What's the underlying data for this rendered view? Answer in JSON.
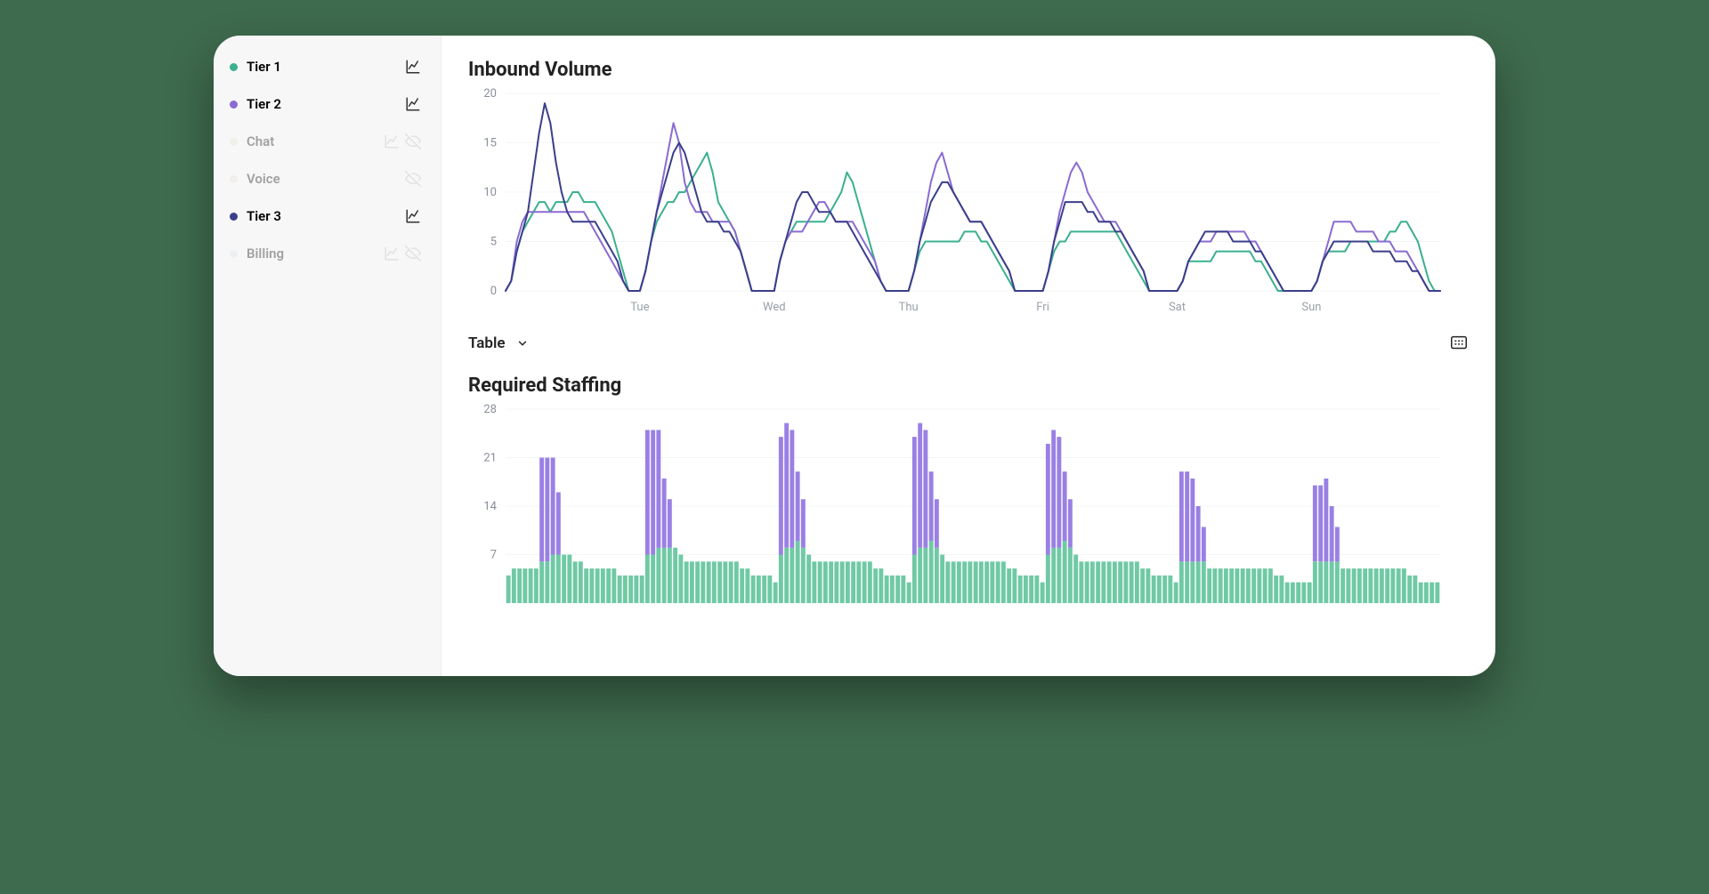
{
  "sidebar": {
    "items": [
      {
        "label": "Tier 1",
        "color": "#3bb08f",
        "active": true,
        "chart": true,
        "hidden": false
      },
      {
        "label": "Tier 2",
        "color": "#8a6bd1",
        "active": true,
        "chart": true,
        "hidden": false
      },
      {
        "label": "Chat",
        "color": "#d6cfa0",
        "active": false,
        "chart": true,
        "hidden": true
      },
      {
        "label": "Voice",
        "color": "#d9c7b8",
        "active": false,
        "chart": false,
        "hidden": true
      },
      {
        "label": "Tier 3",
        "color": "#3b3f8a",
        "active": true,
        "chart": true,
        "hidden": false
      },
      {
        "label": "Billing",
        "color": "#bcd3df",
        "active": false,
        "chart": true,
        "hidden": true
      }
    ]
  },
  "controls": {
    "table_label": "Table"
  },
  "chart_data": [
    {
      "type": "line",
      "title": "Inbound Volume",
      "ylim": [
        0,
        20
      ],
      "yticks": [
        0,
        5,
        10,
        15,
        20
      ],
      "xticks": [
        "Tue",
        "Wed",
        "Thu",
        "Fri",
        "Sat",
        "Sun"
      ],
      "xtick_positions": [
        24,
        48,
        72,
        96,
        120,
        144
      ],
      "n": 168,
      "series": [
        {
          "name": "Tier 1",
          "color": "#3bb08f",
          "values": [
            0,
            1,
            4,
            6,
            7,
            8,
            9,
            9,
            8,
            9,
            9,
            9,
            10,
            10,
            9,
            9,
            9,
            8,
            7,
            6,
            4,
            2,
            0,
            0,
            0,
            2,
            5,
            7,
            8,
            9,
            9,
            10,
            10,
            11,
            12,
            13,
            14,
            12,
            9,
            8,
            7,
            6,
            4,
            2,
            0,
            0,
            0,
            0,
            0,
            3,
            5,
            6,
            7,
            7,
            7,
            7,
            7,
            7,
            8,
            9,
            10,
            12,
            11,
            9,
            7,
            5,
            3,
            1,
            0,
            0,
            0,
            0,
            0,
            2,
            4,
            5,
            5,
            5,
            5,
            5,
            5,
            5,
            6,
            6,
            6,
            5,
            5,
            4,
            3,
            2,
            1,
            0,
            0,
            0,
            0,
            0,
            0,
            2,
            4,
            5,
            5,
            6,
            6,
            6,
            6,
            6,
            6,
            6,
            6,
            6,
            5,
            4,
            3,
            2,
            1,
            0,
            0,
            0,
            0,
            0,
            0,
            1,
            3,
            3,
            3,
            3,
            3,
            4,
            4,
            4,
            4,
            4,
            4,
            4,
            3,
            3,
            2,
            1,
            0,
            0,
            0,
            0,
            0,
            0,
            0,
            1,
            3,
            4,
            4,
            4,
            4,
            5,
            5,
            5,
            5,
            5,
            5,
            5,
            6,
            6,
            7,
            7,
            6,
            5,
            3,
            1,
            0,
            0
          ]
        },
        {
          "name": "Tier 2",
          "color": "#8a6bd1",
          "values": [
            0,
            1,
            5,
            7,
            8,
            8,
            8,
            8,
            8,
            8,
            8,
            8,
            8,
            8,
            8,
            7,
            6,
            5,
            4,
            3,
            2,
            1,
            0,
            0,
            0,
            2,
            5,
            8,
            11,
            14,
            17,
            15,
            11,
            9,
            8,
            8,
            8,
            7,
            7,
            7,
            7,
            6,
            4,
            2,
            0,
            0,
            0,
            0,
            0,
            3,
            5,
            6,
            6,
            6,
            7,
            8,
            9,
            9,
            8,
            7,
            7,
            7,
            7,
            6,
            5,
            4,
            3,
            1,
            0,
            0,
            0,
            0,
            0,
            2,
            5,
            8,
            11,
            13,
            14,
            12,
            10,
            9,
            8,
            7,
            7,
            7,
            6,
            5,
            4,
            3,
            2,
            0,
            0,
            0,
            0,
            0,
            0,
            2,
            5,
            8,
            10,
            12,
            13,
            12,
            10,
            9,
            8,
            7,
            7,
            7,
            6,
            5,
            4,
            3,
            2,
            0,
            0,
            0,
            0,
            0,
            0,
            1,
            3,
            4,
            5,
            5,
            5,
            6,
            6,
            6,
            6,
            6,
            6,
            5,
            5,
            4,
            3,
            2,
            1,
            0,
            0,
            0,
            0,
            0,
            0,
            1,
            3,
            5,
            7,
            7,
            7,
            7,
            6,
            6,
            6,
            6,
            5,
            5,
            5,
            4,
            4,
            4,
            3,
            2,
            1,
            0,
            0,
            0
          ]
        },
        {
          "name": "Tier 3",
          "color": "#3b3f8a",
          "values": [
            0,
            1,
            4,
            6,
            8,
            12,
            16,
            19,
            17,
            13,
            10,
            8,
            7,
            7,
            7,
            7,
            7,
            6,
            5,
            4,
            3,
            1,
            0,
            0,
            0,
            2,
            5,
            8,
            10,
            12,
            14,
            15,
            14,
            12,
            10,
            8,
            7,
            7,
            7,
            6,
            6,
            5,
            4,
            2,
            0,
            0,
            0,
            0,
            0,
            3,
            5,
            7,
            9,
            10,
            10,
            9,
            8,
            8,
            8,
            7,
            7,
            7,
            6,
            5,
            4,
            3,
            2,
            1,
            0,
            0,
            0,
            0,
            0,
            2,
            5,
            7,
            9,
            10,
            11,
            11,
            10,
            9,
            8,
            7,
            7,
            7,
            6,
            5,
            4,
            3,
            2,
            0,
            0,
            0,
            0,
            0,
            0,
            2,
            5,
            7,
            9,
            9,
            9,
            9,
            8,
            8,
            7,
            7,
            7,
            6,
            6,
            5,
            4,
            3,
            2,
            0,
            0,
            0,
            0,
            0,
            0,
            1,
            3,
            4,
            5,
            6,
            6,
            6,
            6,
            6,
            5,
            5,
            5,
            5,
            4,
            4,
            3,
            2,
            1,
            0,
            0,
            0,
            0,
            0,
            0,
            1,
            3,
            4,
            5,
            5,
            5,
            5,
            5,
            5,
            5,
            4,
            4,
            4,
            4,
            3,
            3,
            3,
            2,
            2,
            1,
            0,
            0,
            0
          ]
        }
      ]
    },
    {
      "type": "bar-stacked",
      "title": "Required Staffing",
      "ylim": [
        0,
        28
      ],
      "yticks": [
        7,
        14,
        21,
        28
      ],
      "n": 168,
      "series": [
        {
          "name": "Tier 1",
          "color": "#6fc9a5",
          "values": [
            4,
            5,
            5,
            5,
            5,
            5,
            6,
            6,
            7,
            7,
            7,
            7,
            6,
            6,
            5,
            5,
            5,
            5,
            5,
            5,
            4,
            4,
            4,
            4,
            4,
            7,
            7,
            8,
            8,
            8,
            8,
            7,
            6,
            6,
            6,
            6,
            6,
            6,
            6,
            6,
            6,
            6,
            5,
            5,
            4,
            4,
            4,
            4,
            3,
            7,
            8,
            8,
            9,
            8,
            7,
            6,
            6,
            6,
            6,
            6,
            6,
            6,
            6,
            6,
            6,
            6,
            5,
            5,
            4,
            4,
            4,
            4,
            3,
            7,
            8,
            8,
            9,
            8,
            7,
            6,
            6,
            6,
            6,
            6,
            6,
            6,
            6,
            6,
            6,
            6,
            5,
            5,
            4,
            4,
            4,
            4,
            3,
            7,
            8,
            8,
            9,
            8,
            7,
            6,
            6,
            6,
            6,
            6,
            6,
            6,
            6,
            6,
            6,
            6,
            5,
            5,
            4,
            4,
            4,
            4,
            3,
            6,
            6,
            6,
            6,
            6,
            5,
            5,
            5,
            5,
            5,
            5,
            5,
            5,
            5,
            5,
            5,
            5,
            4,
            4,
            3,
            3,
            3,
            3,
            3,
            6,
            6,
            6,
            6,
            6,
            5,
            5,
            5,
            5,
            5,
            5,
            5,
            5,
            5,
            5,
            5,
            5,
            4,
            4,
            3,
            3,
            3,
            3
          ]
        },
        {
          "name": "Tier 2",
          "color": "#9a80e4",
          "values": [
            0,
            0,
            0,
            0,
            0,
            0,
            15,
            15,
            14,
            9,
            0,
            0,
            0,
            0,
            0,
            0,
            0,
            0,
            0,
            0,
            0,
            0,
            0,
            0,
            0,
            18,
            18,
            17,
            10,
            7,
            0,
            0,
            0,
            0,
            0,
            0,
            0,
            0,
            0,
            0,
            0,
            0,
            0,
            0,
            0,
            0,
            0,
            0,
            0,
            17,
            18,
            17,
            10,
            7,
            0,
            0,
            0,
            0,
            0,
            0,
            0,
            0,
            0,
            0,
            0,
            0,
            0,
            0,
            0,
            0,
            0,
            0,
            0,
            17,
            18,
            17,
            10,
            7,
            0,
            0,
            0,
            0,
            0,
            0,
            0,
            0,
            0,
            0,
            0,
            0,
            0,
            0,
            0,
            0,
            0,
            0,
            0,
            16,
            17,
            16,
            10,
            7,
            0,
            0,
            0,
            0,
            0,
            0,
            0,
            0,
            0,
            0,
            0,
            0,
            0,
            0,
            0,
            0,
            0,
            0,
            0,
            13,
            13,
            12,
            8,
            5,
            0,
            0,
            0,
            0,
            0,
            0,
            0,
            0,
            0,
            0,
            0,
            0,
            0,
            0,
            0,
            0,
            0,
            0,
            0,
            11,
            11,
            12,
            8,
            5,
            0,
            0,
            0,
            0,
            0,
            0,
            0,
            0,
            0,
            0,
            0,
            0,
            0,
            0,
            0,
            0,
            0,
            0
          ]
        }
      ]
    }
  ]
}
